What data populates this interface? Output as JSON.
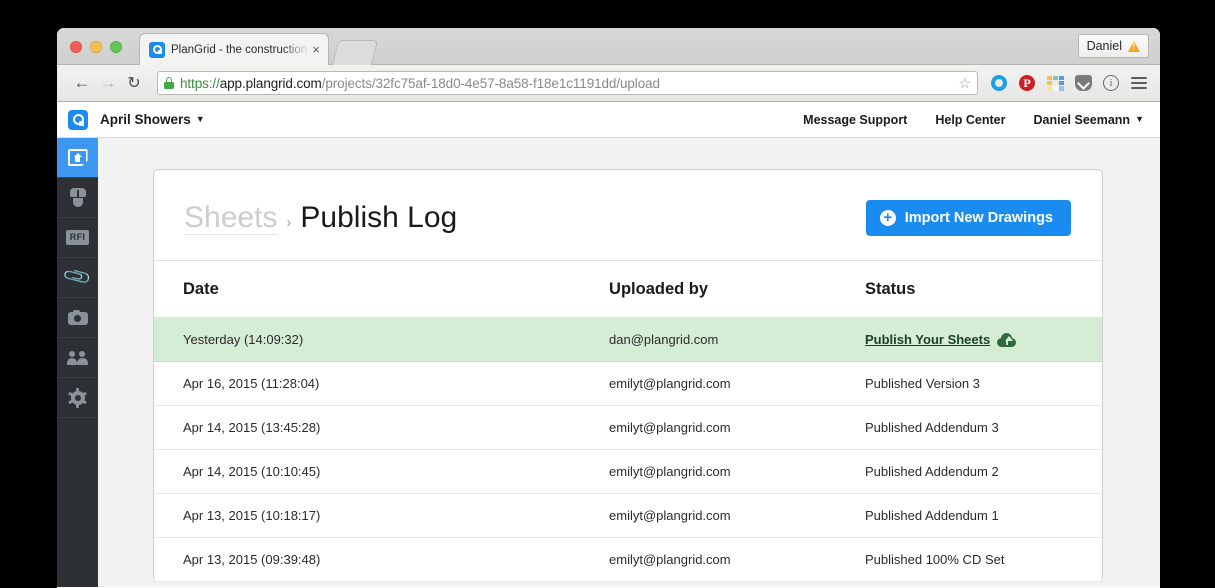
{
  "browser": {
    "tab": {
      "title": "PlanGrid - the construction",
      "favicon": "plangrid-logo-icon",
      "close_label": "×"
    },
    "new_tab_label": "",
    "profile": {
      "name": "Daniel",
      "warning_icon": "warning-triangle-icon"
    },
    "nav": {
      "back": "←",
      "forward": "→",
      "reload": "↻"
    },
    "omnibox": {
      "lock_icon": "lock-icon",
      "url_scheme": "https://",
      "url_host": "app.plangrid.com",
      "url_path": "/projects/32fc75af-18d0-4e57-8a58-f18e1c1191dd/upload",
      "full_url": "https://app.plangrid.com/projects/32fc75af-18d0-4e57-8a58-f18e1c1191dd/upload",
      "bookmark_icon": "☆"
    },
    "extensions": [
      {
        "name": "blue-ring-icon"
      },
      {
        "name": "pinterest-icon",
        "glyph": "P"
      },
      {
        "name": "color-grid-icon"
      },
      {
        "name": "pocket-shield-icon"
      },
      {
        "name": "info-circle-icon",
        "glyph": "i"
      },
      {
        "name": "hamburger-menu-icon"
      }
    ]
  },
  "app_header": {
    "logo": "plangrid-logo-icon",
    "project_name": "April Showers",
    "project_caret": "▼",
    "links": [
      {
        "label": "Message Support"
      },
      {
        "label": "Help Center"
      }
    ],
    "user": {
      "name": "Daniel Seemann",
      "caret": "▼"
    }
  },
  "sidebar": {
    "items": [
      {
        "name": "sheets",
        "icon": "sheets-icon",
        "active": true
      },
      {
        "name": "punchlist",
        "icon": "punchlist-icon",
        "active": false
      },
      {
        "name": "rfi",
        "icon": "rfi-icon",
        "label": "RFI",
        "active": false
      },
      {
        "name": "documents",
        "icon": "paperclip-icon",
        "active": false
      },
      {
        "name": "photos",
        "icon": "camera-icon",
        "active": false
      },
      {
        "name": "people",
        "icon": "people-icon",
        "active": false
      },
      {
        "name": "settings",
        "icon": "gear-icon",
        "active": false
      }
    ]
  },
  "main": {
    "breadcrumb": {
      "parent": "Sheets",
      "separator": "›",
      "current": "Publish Log"
    },
    "import_button": {
      "label": "Import New Drawings",
      "icon": "plus-circle-icon",
      "color": "#1a8cf0"
    },
    "table": {
      "headers": {
        "date": "Date",
        "uploaded_by": "Uploaded by",
        "status": "Status"
      },
      "highlight_color": "#d5ecd5",
      "rows": [
        {
          "date": "Yesterday (14:09:32)",
          "uploaded_by": "dan@plangrid.com",
          "status": "Publish Your Sheets",
          "status_is_link": true,
          "status_icon": "cloud-upload-icon",
          "highlighted": true
        },
        {
          "date": "Apr 16, 2015 (11:28:04)",
          "uploaded_by": "emilyt@plangrid.com",
          "status": "Published Version 3",
          "status_is_link": false,
          "highlighted": false
        },
        {
          "date": "Apr 14, 2015 (13:45:28)",
          "uploaded_by": "emilyt@plangrid.com",
          "status": "Published Addendum 3",
          "status_is_link": false,
          "highlighted": false
        },
        {
          "date": "Apr 14, 2015 (10:10:45)",
          "uploaded_by": "emilyt@plangrid.com",
          "status": "Published Addendum 2",
          "status_is_link": false,
          "highlighted": false
        },
        {
          "date": "Apr 13, 2015 (10:18:17)",
          "uploaded_by": "emilyt@plangrid.com",
          "status": "Published Addendum 1",
          "status_is_link": false,
          "highlighted": false
        },
        {
          "date": "Apr 13, 2015 (09:39:48)",
          "uploaded_by": "emilyt@plangrid.com",
          "status": "Published 100% CD Set",
          "status_is_link": false,
          "highlighted": false
        }
      ]
    }
  }
}
